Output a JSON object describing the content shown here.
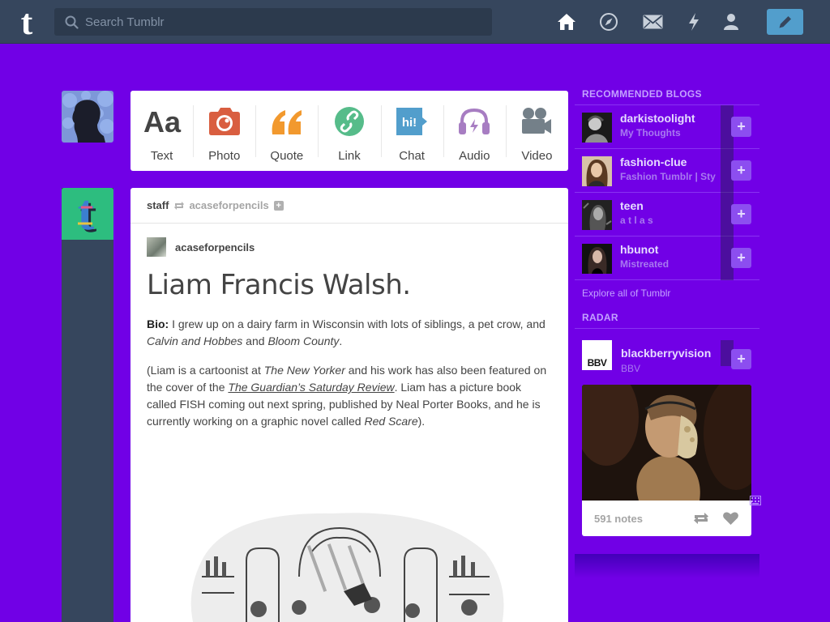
{
  "header": {
    "search_placeholder": "Search Tumblr",
    "nav": [
      "home-icon",
      "explore-icon",
      "messages-icon",
      "activity-icon",
      "account-icon"
    ],
    "compose_icon": "pencil-icon"
  },
  "post_types": [
    {
      "label": "Text",
      "icon": "text-icon",
      "color": "#444444"
    },
    {
      "label": "Photo",
      "icon": "camera-icon",
      "color": "#d95e40"
    },
    {
      "label": "Quote",
      "icon": "quote-icon",
      "color": "#f2992e"
    },
    {
      "label": "Link",
      "icon": "link-icon",
      "color": "#56bc8a"
    },
    {
      "label": "Chat",
      "icon": "chat-icon",
      "color": "#529ecc"
    },
    {
      "label": "Audio",
      "icon": "audio-icon",
      "color": "#a77dc2"
    },
    {
      "label": "Video",
      "icon": "video-icon",
      "color": "#748089"
    }
  ],
  "post": {
    "author": "staff",
    "reblogged_from": "acaseforpencils",
    "source": "acaseforpencils",
    "title": "Liam Francis Walsh.",
    "bio_label": "Bio:",
    "bio_text_1": " I grew up on a dairy farm in Wisconsin with lots of siblings, a pet crow, and ",
    "bio_italic_1": "Calvin and Hobbes",
    "bio_text_2": " and ",
    "bio_italic_2": "Bloom County",
    "bio_text_3": ".",
    "p2_text_1": "(Liam is a cartoonist at ",
    "p2_italic_1": "The New Yorker",
    "p2_text_2": " and his work has also been featured on the cover of the ",
    "p2_link": "The Guardian’s Saturday Review",
    "p2_text_3": ". Liam has a picture book called FISH coming out next spring, published by Neal Porter Books, and he is currently working on a graphic novel called ",
    "p2_italic_2": "Red Scare",
    "p2_text_4": ")."
  },
  "sidebar": {
    "recommended_title": "RECOMMENDED BLOGS",
    "blogs": [
      {
        "name": "darkistoolight",
        "desc": "My Thoughts"
      },
      {
        "name": "fashion-clue",
        "desc": "Fashion Tumblr | Sty"
      },
      {
        "name": "teen",
        "desc": "a t l a s"
      },
      {
        "name": "hbunot",
        "desc": "Mistreated"
      }
    ],
    "explore_label": "Explore all of Tumblr",
    "radar_title": "RADAR",
    "radar": {
      "logo_text": "BBV",
      "name": "blackberryvision",
      "desc": "BBV",
      "notes": "591 notes"
    },
    "follow_symbol": "+"
  },
  "colors": {
    "background": "#7100e6",
    "header": "#36465d",
    "compose": "#529ecc"
  }
}
